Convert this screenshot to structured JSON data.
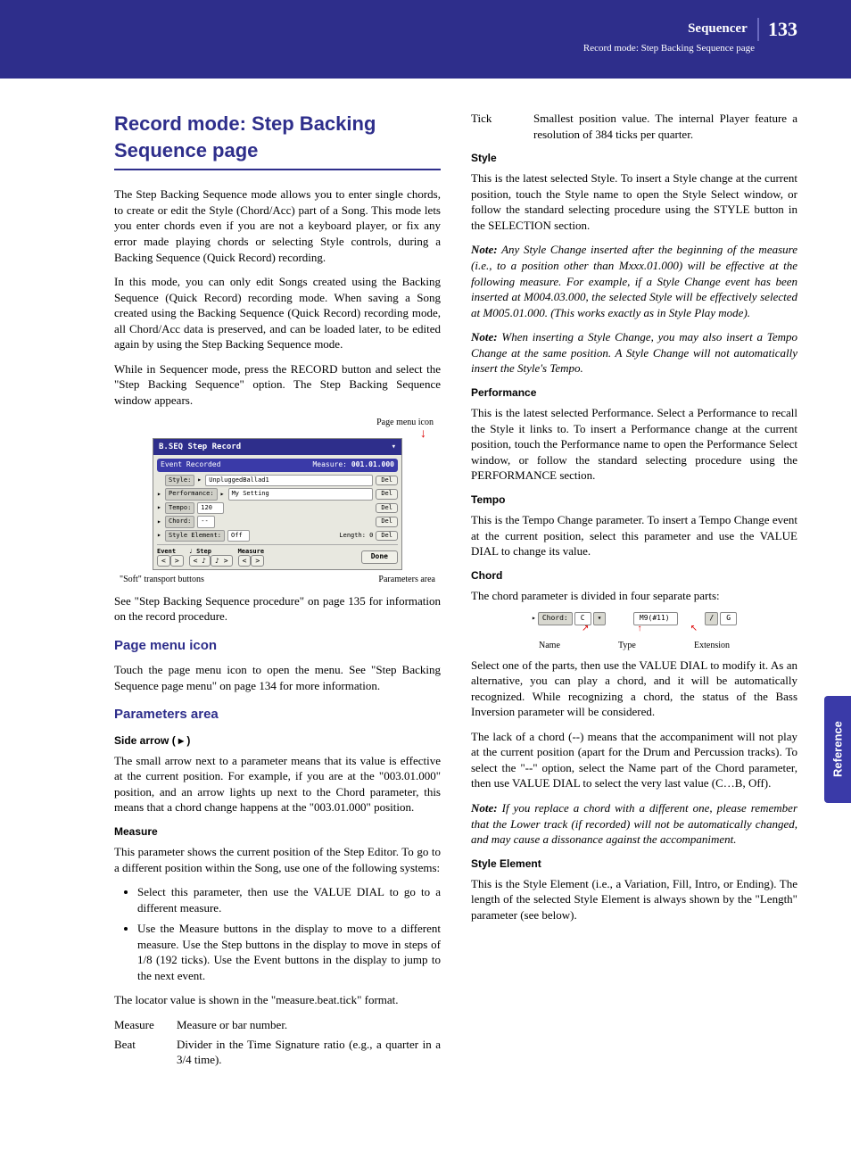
{
  "header": {
    "section": "Sequencer",
    "page_num": "133",
    "subtitle": "Record mode: Step Backing Sequence page"
  },
  "side_tab": "Reference",
  "col1": {
    "h1": "Record mode: Step Backing Sequence page",
    "p1": "The Step Backing Sequence mode allows you to enter single chords, to create or edit the Style (Chord/Acc) part of a Song. This mode lets you enter chords even if you are not a keyboard player, or fix any error made playing chords or selecting Style controls, during a Backing Sequence (Quick Record) recording.",
    "p2": "In this mode, you can only edit Songs created using the Backing Sequence (Quick Record) recording mode. When saving a Song created using the Backing Sequence (Quick Record) recording mode, all Chord/Acc data is preserved, and can be loaded later, to be edited again by using the Step Backing Sequence mode.",
    "p3": "While in Sequencer mode, press the RECORD button and select the \"Step Backing Sequence\" option. The Step Backing Sequence window appears.",
    "scr_top_label": "Page menu icon",
    "scr": {
      "title": "B.SEQ Step Record",
      "hdr2_left": "Event Recorded",
      "hdr2_right_lbl": "Measure:",
      "hdr2_right_val": "001.01.000",
      "rows": {
        "style_lbl": "Style:",
        "style_val": "UnpluggedBallad1",
        "perf_lbl": "Performance:",
        "perf_val": "My Setting",
        "tempo_lbl": "Tempo:",
        "tempo_val": "120",
        "chord_lbl": "Chord:",
        "chord_val": "--",
        "se_lbl": "Style Element:",
        "se_val": "Off",
        "len_lbl": "Length: 0"
      },
      "del": "Del",
      "foot": {
        "event": "Event",
        "step": "♩ Step",
        "measure": "Measure",
        "done": "Done"
      }
    },
    "scr_cap_left": "\"Soft\" transport buttons",
    "scr_cap_right": "Parameters area",
    "p4": "See \"Step Backing Sequence procedure\" on page 135 for information on the record procedure.",
    "h2a": "Page menu icon",
    "p5": "Touch the page menu icon to open the menu. See \"Step Backing Sequence page menu\" on page 134 for more information.",
    "h2b": "Parameters area",
    "h3a": "Side arrow ( ▸ )",
    "p6": "The small arrow next to a parameter means that its value is effective at the current position. For example, if you are at the \"003.01.000\" position, and an arrow lights up next to the Chord parameter, this means that a chord change happens at the \"003.01.000\" position.",
    "h3b": "Measure",
    "p7": "This parameter shows the current position of the Step Editor. To go to a different position within the Song, use one of the following systems:",
    "b1": "Select this parameter, then use the VALUE DIAL to go to a different measure.",
    "b2": "Use the Measure buttons in the display to move to a different measure. Use the Step buttons in the display to move in steps of 1/8 (192 ticks). Use the Event buttons in the display to jump to the next event."
  },
  "col2": {
    "p1": "The locator value is shown in the \"measure.beat.tick\" format.",
    "d1_t": "Measure",
    "d1_d": "Measure or bar number.",
    "d2_t": "Beat",
    "d2_d": "Divider in the Time Signature ratio (e.g., a quarter in a 3/4 time).",
    "d3_t": "Tick",
    "d3_d": "Smallest position value. The internal Player feature a resolution of 384 ticks per quarter.",
    "h3a": "Style",
    "p2": "This is the latest selected Style. To insert a Style change at the current position, touch the Style name to open the Style Select window, or follow the standard selecting procedure using the STYLE button in the SELECTION section.",
    "n1": "Any Style Change inserted after the beginning of the measure (i.e., to a position other than Mxxx.01.000) will be effective at the following measure. For example, if a Style Change event has been inserted at M004.03.000, the selected Style will be effectively selected at M005.01.000. (This works exactly as in Style Play mode).",
    "n2": "When inserting a Style Change, you may also insert a Tempo Change at the same position. A Style Change will not automatically insert the Style's Tempo.",
    "h3b": "Performance",
    "p3": "This is the latest selected Performance. Select a Performance to recall the Style it links to. To insert a Performance change at the current position, touch the Performance name to open the Performance Select window, or follow the standard selecting procedure using the PERFORMANCE section.",
    "h3c": "Tempo",
    "p4": "This is the Tempo Change parameter. To insert a Tempo Change event at the current position, select this parameter and use the VALUE DIAL to change its value.",
    "h3d": "Chord",
    "p5": "The chord parameter is divided in four separate parts:",
    "chord": {
      "lbl": "Chord:",
      "name_v": "C",
      "type_v": "M9(#11)",
      "slash": "/",
      "ext_v": "G",
      "name": "Name",
      "type": "Type",
      "ext": "Extension"
    },
    "p6": "Select one of the parts, then use the VALUE DIAL to modify it. As an alternative, you can play a chord, and it will be automatically recognized. While recognizing a chord, the status of the Bass Inversion parameter will be considered.",
    "p7": "The lack of a chord (--) means that the accompaniment will not play at the current position (apart for the Drum and Percussion tracks). To select the \"--\" option, select the Name part of the Chord parameter, then use VALUE DIAL to select the very last value (C…B, Off).",
    "n3": "If you replace a chord with a different one, please remember that the Lower track (if recorded) will not be automatically changed, and may cause a dissonance against the accompaniment.",
    "h3e": "Style Element",
    "p8": "This is the Style Element (i.e., a Variation, Fill, Intro, or Ending). The length of the selected Style Element is always shown by the \"Length\" parameter (see below)."
  }
}
